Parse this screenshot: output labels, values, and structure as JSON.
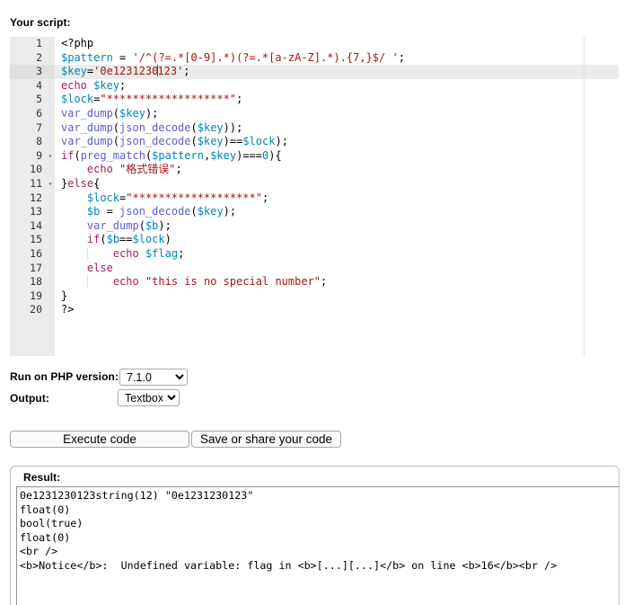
{
  "script_section": {
    "label": "Your script:"
  },
  "editor": {
    "active_line": 3,
    "caret_line": 3,
    "lines": [
      {
        "n": "1",
        "text": "<?php"
      },
      {
        "n": "2",
        "text": "$pattern = '/^(?=.*[0-9].*)(?=.*[a-zA-Z].*).{7,}$/ ';"
      },
      {
        "n": "3",
        "text": "$key='0e1231230123';"
      },
      {
        "n": "4",
        "text": "echo $key;"
      },
      {
        "n": "5",
        "text": "$lock=\"*******************\";"
      },
      {
        "n": "6",
        "text": "var_dump($key);"
      },
      {
        "n": "7",
        "text": "var_dump(json_decode($key));"
      },
      {
        "n": "8",
        "text": "var_dump(json_decode($key)==$lock);"
      },
      {
        "n": "9",
        "text": "if(preg_match($pattern,$key)===0){",
        "fold": "▾"
      },
      {
        "n": "10",
        "text": "    echo \"格式错误\";"
      },
      {
        "n": "11",
        "text": "}else{",
        "fold": "▾"
      },
      {
        "n": "12",
        "text": "    $lock=\"*******************\";"
      },
      {
        "n": "13",
        "text": "    $b = json_decode($key);"
      },
      {
        "n": "14",
        "text": "    var_dump($b);"
      },
      {
        "n": "15",
        "text": "    if($b==$lock)"
      },
      {
        "n": "16",
        "text": "        echo $flag;"
      },
      {
        "n": "17",
        "text": "    else"
      },
      {
        "n": "18",
        "text": "        echo \"this is no special number\";"
      },
      {
        "n": "19",
        "text": "}"
      },
      {
        "n": "20",
        "text": "?>"
      }
    ]
  },
  "options": {
    "php_version_label": "Run on PHP version:",
    "php_version_value": "7.1.0",
    "php_version_options": [
      "7.1.0"
    ],
    "output_label": "Output:",
    "output_value": "Textbox",
    "output_options": [
      "Textbox"
    ]
  },
  "buttons": {
    "execute": "Execute code",
    "save": "Save or share your code"
  },
  "result": {
    "label": "Result:",
    "lines": [
      "0e1231230123string(12) \"0e1231230123\"",
      "float(0)",
      "bool(true)",
      "float(0)",
      "<br />",
      "<b>Notice</b>:  Undefined variable: flag in <b>[...][...]</b> on line <b>16</b><br />"
    ]
  },
  "colors": {
    "gutter_bg": "#ebebeb",
    "active_line_bg": "#ebebeb",
    "variable": "#0086b3",
    "string": "#a31515",
    "keyword": "#a71d5d",
    "function": "#5c5cd6",
    "ruler": "#e2e2e2"
  }
}
